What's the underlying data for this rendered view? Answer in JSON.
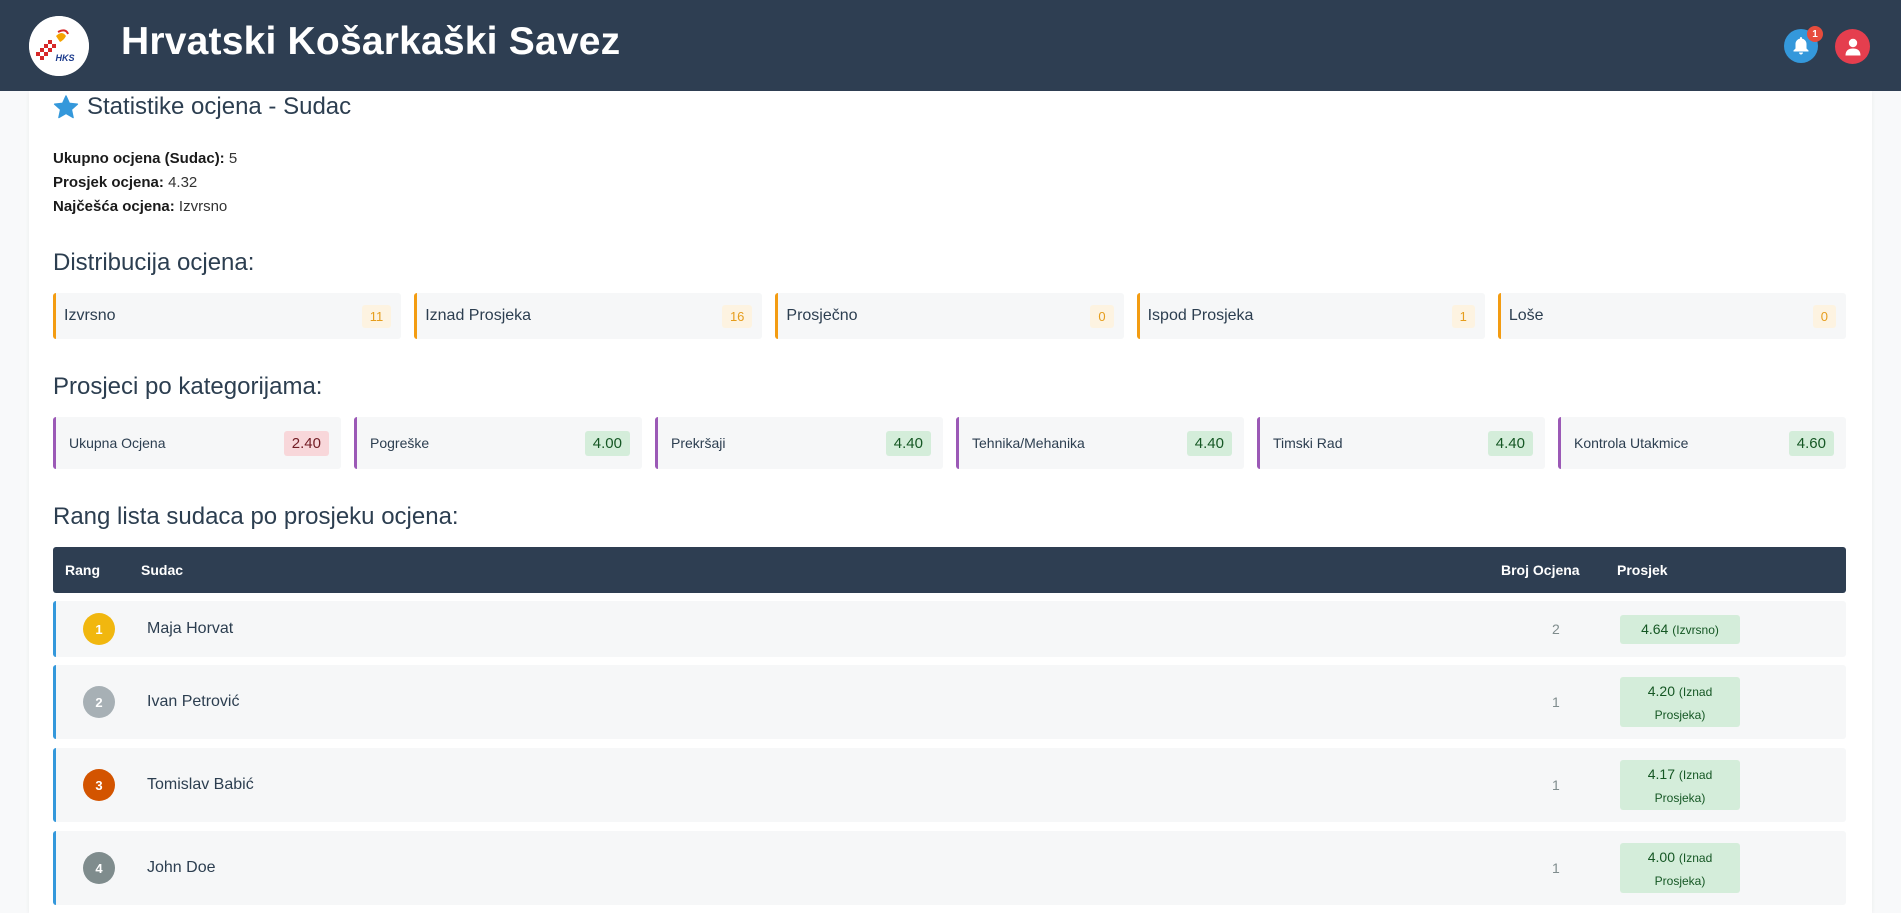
{
  "header": {
    "brand": "Hrvatski Košarkaški Savez",
    "logo_text": "HKS",
    "notification_count": "1"
  },
  "stats": {
    "title": "Statistike ocjena - Sudac",
    "summary": [
      {
        "label": "Ukupno ocjena (Sudac):",
        "value": "5"
      },
      {
        "label": "Prosjek ocjena:",
        "value": "4.32"
      },
      {
        "label": "Najčešća ocjena:",
        "value": "Izvrsno"
      }
    ]
  },
  "distribution": {
    "heading": "Distribucija ocjena:",
    "items": [
      {
        "label": "Izvrsno",
        "count": "11"
      },
      {
        "label": "Iznad Prosjeka",
        "count": "16"
      },
      {
        "label": "Prosječno",
        "count": "0"
      },
      {
        "label": "Ispod Prosjeka",
        "count": "1"
      },
      {
        "label": "Loše",
        "count": "0"
      }
    ]
  },
  "categories": {
    "heading": "Prosjeci po kategorijama:",
    "items": [
      {
        "label": "Ukupna Ocjena",
        "value": "2.40",
        "status": "low"
      },
      {
        "label": "Pogreške",
        "value": "4.00",
        "status": "good"
      },
      {
        "label": "Prekršaji",
        "value": "4.40",
        "status": "good"
      },
      {
        "label": "Tehnika/Mehanika",
        "value": "4.40",
        "status": "good"
      },
      {
        "label": "Timski Rad",
        "value": "4.40",
        "status": "good"
      },
      {
        "label": "Kontrola Utakmice",
        "value": "4.60",
        "status": "good"
      }
    ]
  },
  "ranking": {
    "heading": "Rang lista sudaca po prosjeku ocjena:",
    "columns": {
      "rank": "Rang",
      "referee": "Sudac",
      "count": "Broj Ocjena",
      "average": "Prosjek"
    },
    "rows": [
      {
        "rank": "1",
        "name": "Maja Horvat",
        "count": "2",
        "avg": "4.64",
        "grade_line1": "(Izvrsno)",
        "grade_line2": "",
        "badge_color": "#f1c40f"
      },
      {
        "rank": "2",
        "name": "Ivan Petrović",
        "count": "1",
        "avg": "4.20",
        "grade_line1": "(Iznad",
        "grade_line2": "Prosjeka)",
        "badge_color": "#95a5a6"
      },
      {
        "rank": "3",
        "name": "Tomislav Babić",
        "count": "1",
        "avg": "4.17",
        "grade_line1": "(Iznad",
        "grade_line2": "Prosjeka)",
        "badge_color": "#d35400"
      },
      {
        "rank": "4",
        "name": "John Doe",
        "count": "1",
        "avg": "4.00",
        "grade_line1": "(Iznad",
        "grade_line2": "Prosjeka)",
        "badge_color": "#7f8c8d"
      }
    ]
  },
  "colors": {
    "header_bg": "#2e3e52",
    "distribution_accent": "#f39c12",
    "category_accent": "#9b59b6",
    "ranking_accent": "#3498db"
  }
}
